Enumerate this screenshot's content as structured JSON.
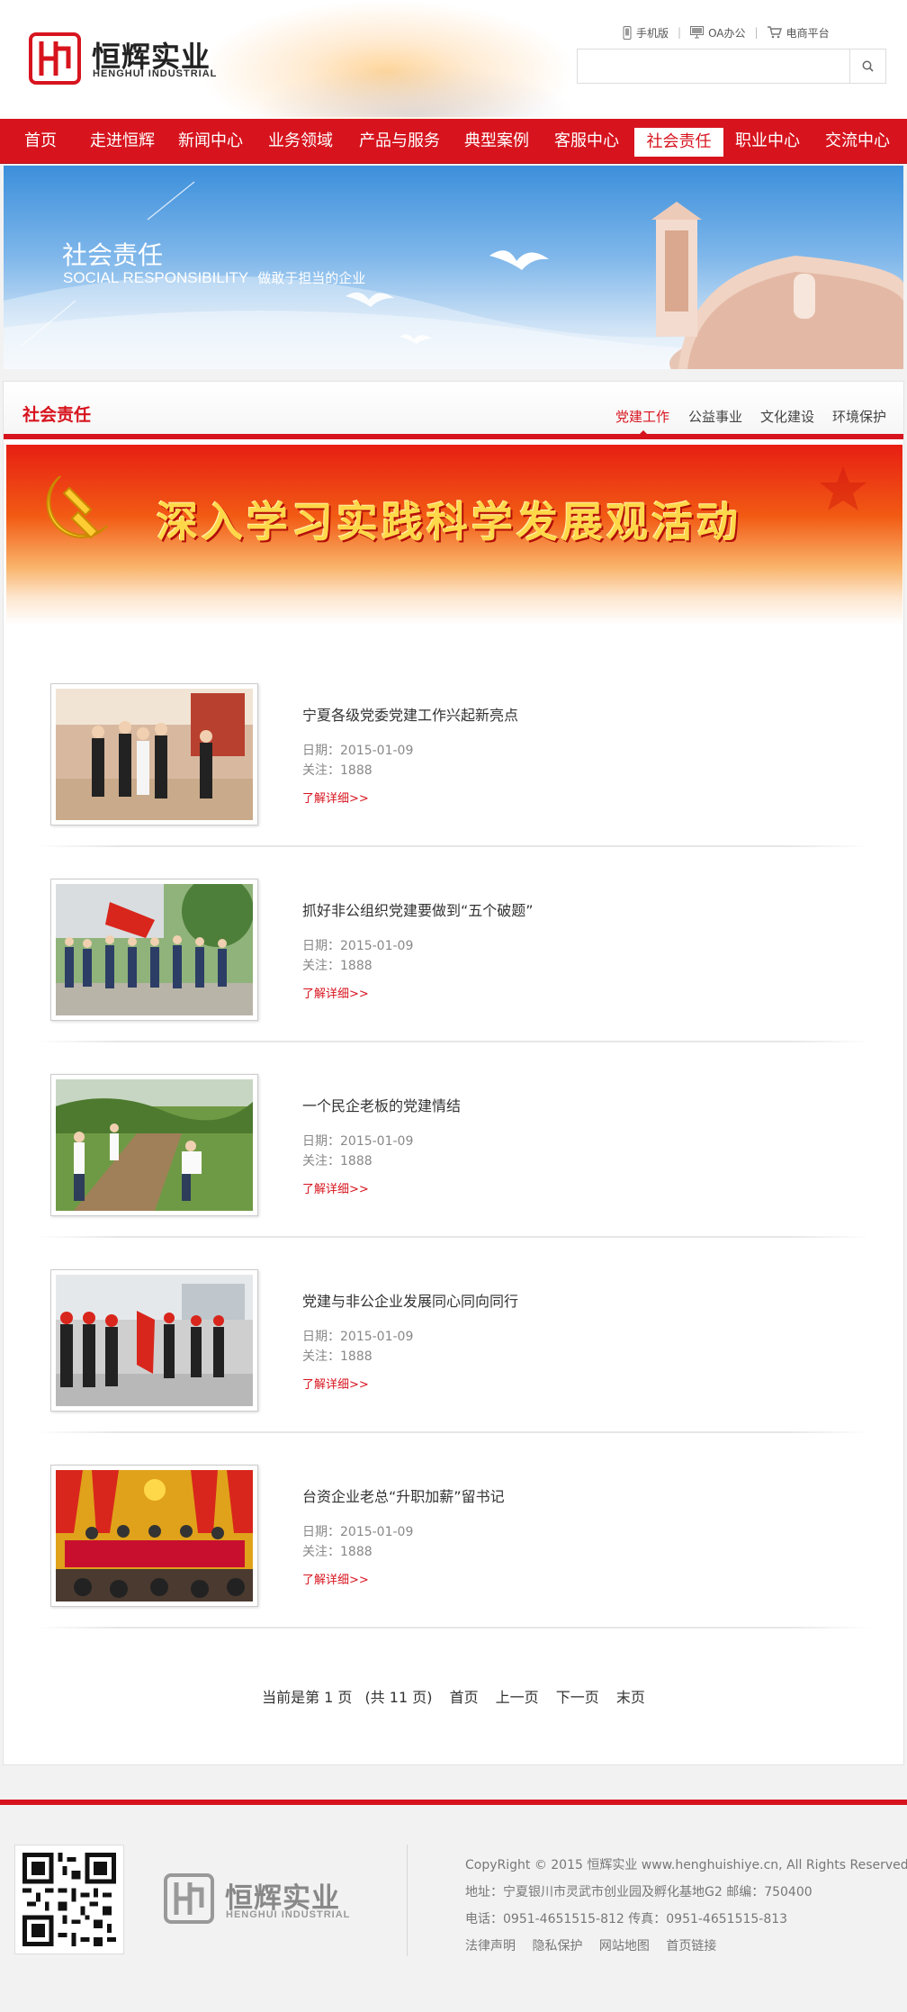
{
  "brand": {
    "name": "恒辉实业",
    "name_en": "HENGHUI INDUSTRIAL",
    "accent": "#d7141e"
  },
  "top_links": [
    {
      "label": "手机版",
      "icon": "mobile-icon"
    },
    {
      "label": "OA办公",
      "icon": "monitor-icon"
    },
    {
      "label": "电商平台",
      "icon": "cart-icon"
    }
  ],
  "search": {
    "placeholder": "",
    "value": "",
    "icon": "search-icon"
  },
  "nav": {
    "items": [
      "首页",
      "走进恒辉",
      "新闻中心",
      "业务领域",
      "产品与服务",
      "典型案例",
      "客服中心",
      "社会责任",
      "职业中心",
      "交流中心"
    ],
    "active": "社会责任"
  },
  "banner": {
    "title": "社会责任",
    "subtitle_en": "SOCIAL RESPONSIBILITY",
    "slogan": "做敢于担当的企业"
  },
  "section": {
    "title": "社会责任",
    "tabs": [
      "党建工作",
      "公益事业",
      "文化建设",
      "环境保护"
    ],
    "active_tab": "党建工作"
  },
  "party_banner": {
    "title": "深入学习实践科学发展观活动"
  },
  "news": [
    {
      "title": "宁夏各级党委党建工作兴起新亮点",
      "date": "日期：2015-01-09",
      "views": "关注：1888",
      "more": "了解详细>>"
    },
    {
      "title": "抓好非公组织党建要做到“五个破题”",
      "date": "日期：2015-01-09",
      "views": "关注：1888",
      "more": "了解详细>>"
    },
    {
      "title": "一个民企老板的党建情结",
      "date": "日期：2015-01-09",
      "views": "关注：1888",
      "more": "了解详细>>"
    },
    {
      "title": "党建与非公企业发展同心同向同行",
      "date": "日期：2015-01-09",
      "views": "关注：1888",
      "more": "了解详细>>"
    },
    {
      "title": "台资企业老总“升职加薪”留书记",
      "date": "日期：2015-01-09",
      "views": "关注：1888",
      "more": "了解详细>>"
    }
  ],
  "pager": {
    "status": "当前是第 1 页",
    "total": "(共 11 页)",
    "first": "首页",
    "prev": "上一页",
    "next": "下一页",
    "last": "末页"
  },
  "footer": {
    "copyright": "CopyRight © 2015 恒辉实业 www.henghuishiye.cn, All Rights Reserved.",
    "address": "地址：宁夏银川市灵武市创业园及孵化基地G2    邮编：750400",
    "phone": "电话：0951-4651515-812    传真：0951-4651515-813",
    "links": [
      "法律声明",
      "隐私保护",
      "网站地图",
      "首页链接"
    ]
  }
}
